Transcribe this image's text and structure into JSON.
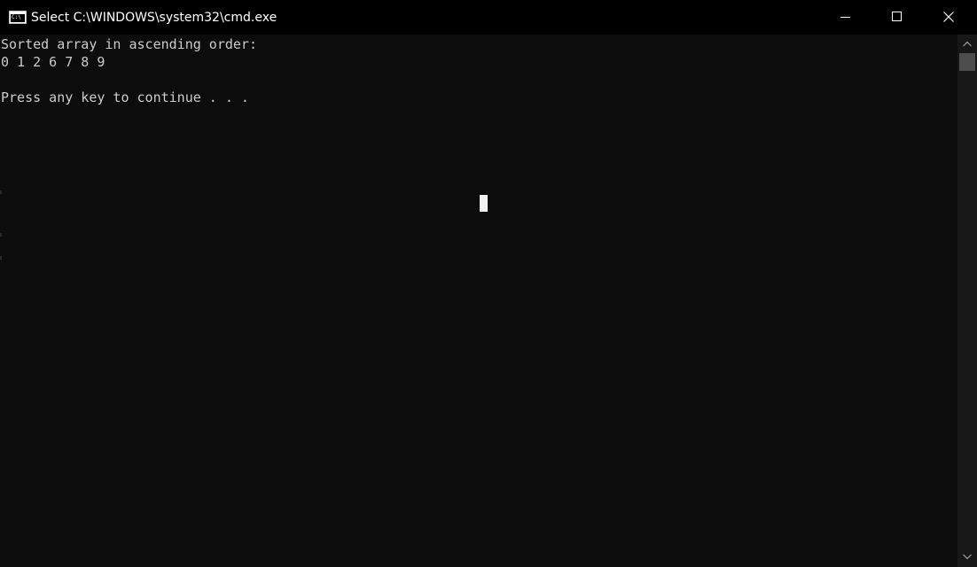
{
  "window": {
    "title": "Select C:\\WINDOWS\\system32\\cmd.exe",
    "icon_label": "C:\\",
    "icon": "cmd-console-icon"
  },
  "caption_buttons": {
    "minimize_icon": "minimize-icon",
    "maximize_icon": "maximize-icon",
    "close_icon": "close-icon"
  },
  "console": {
    "lines": [
      "Sorted array in ascending order:",
      "0 1 2 6 7 8 9",
      "",
      "Press any key to continue . . ."
    ],
    "foreground": "#cccccc",
    "background": "#0c0c0c"
  },
  "scrollbar": {
    "up_icon": "scroll-up-arrow-icon",
    "down_icon": "scroll-down-arrow-icon"
  }
}
